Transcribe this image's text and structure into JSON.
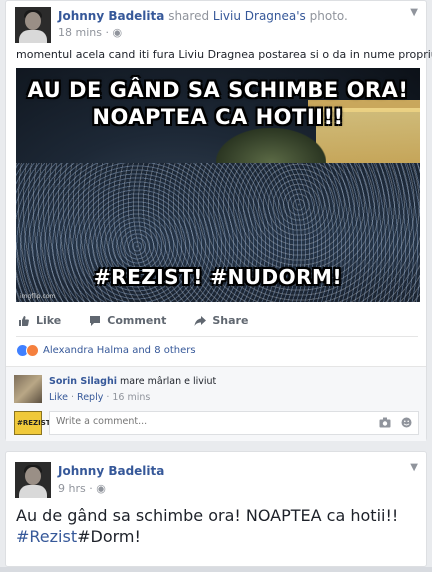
{
  "post1": {
    "author": "Johnny Badelita",
    "shared_text": " shared ",
    "shared_owner": "Liviu Dragnea's",
    "shared_object": " photo.",
    "time": "18 mins",
    "privacy_icon": "globe-icon",
    "text": "momentul acela cand iti fura Liviu Dragnea postarea si o da in nume propriu!!!",
    "image": {
      "caption_top_1": "AU DE GÂND SA SCHIMBE ORA!",
      "caption_top_2": "NOAPTEA   CA   HOTII!!",
      "caption_bottom": "#REZIST!  #NUDORM!",
      "watermark": "imgflip.com"
    },
    "actions": {
      "like": "Like",
      "comment": "Comment",
      "share": "Share"
    },
    "reactions": {
      "names": "Alexandra Halma and 8 others",
      "colors": {
        "like": "#4080ff",
        "angry": "#f5803e"
      }
    },
    "comment": {
      "author": "Sorin Silaghi",
      "text": "mare mârlan e liviut",
      "like": "Like",
      "reply": "Reply",
      "time": "16 mins",
      "separator": " · "
    },
    "write_comment": {
      "placeholder": "Write a comment...",
      "avatar_text": "#REZIST"
    }
  },
  "post2": {
    "author": "Johnny Badelita",
    "time": "9 hrs",
    "privacy_icon": "globe-icon",
    "text_main": "Au de gând sa schimbe ora! NOAPTEA ca hotii!! ",
    "hashtag": "#Rezist",
    "text_tail": "#Dorm!"
  },
  "colors": {
    "link": "#365899",
    "muted": "#90949c",
    "background": "#e9ebee"
  }
}
